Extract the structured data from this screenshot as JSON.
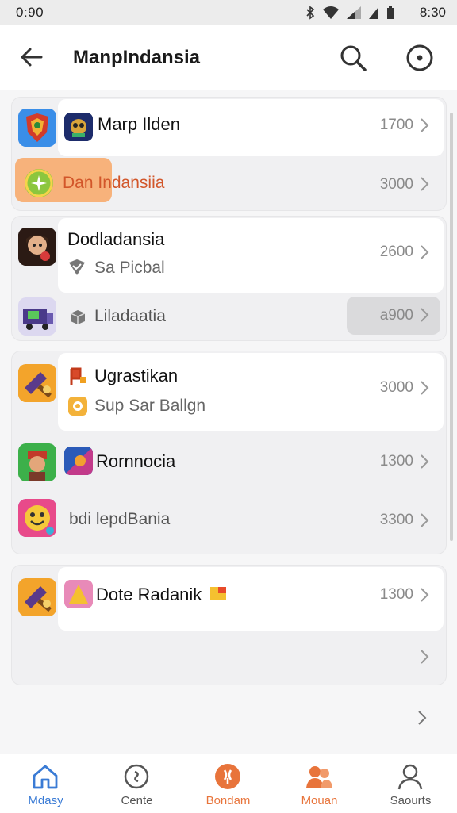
{
  "status": {
    "time_left": "0:90",
    "time_right": "8:30"
  },
  "header": {
    "title": "ManpIndansia"
  },
  "cards": [
    {
      "rows": [
        {
          "label": "Marp Ilden",
          "value": "1700"
        },
        {
          "label": "Dan Indansiia",
          "value": "3000"
        }
      ]
    },
    {
      "rows": [
        {
          "label": "Dodladansia",
          "sublabel": "Sa Picbal",
          "value": "2600"
        },
        {
          "label": "Liladaatia",
          "value": "a900"
        }
      ]
    },
    {
      "rows": [
        {
          "label": "Ugrastikan",
          "sublabel": "Sup Sar Ballgn",
          "value": "3000"
        },
        {
          "label": "Rornnocia",
          "value": "1300"
        },
        {
          "label": "bdi lepdBania",
          "value": "3300"
        }
      ]
    },
    {
      "rows": [
        {
          "label": "Dote Radanik",
          "value": "1300"
        }
      ]
    }
  ],
  "nav": [
    {
      "label": "Mdasy",
      "icon": "home-icon",
      "color": "#3a7bd5"
    },
    {
      "label": "Cente",
      "icon": "compass-icon",
      "color": "#555555"
    },
    {
      "label": "Bondam",
      "icon": "heart-badge-icon",
      "color": "#e8743b"
    },
    {
      "label": "Mouan",
      "icon": "people-icon",
      "color": "#e8743b"
    },
    {
      "label": "Saourts",
      "icon": "person-icon",
      "color": "#555555"
    }
  ],
  "colors": {
    "accent": "#e8743b",
    "highlight": "#f7b27b",
    "link_blue": "#3a7bd5"
  }
}
